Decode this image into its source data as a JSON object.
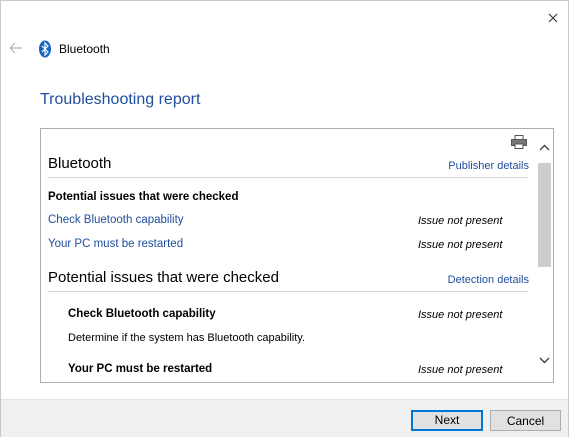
{
  "window": {
    "app_title": "Bluetooth",
    "page_title": "Troubleshooting report"
  },
  "report": {
    "section1_title": "Bluetooth",
    "publisher_link": "Publisher details",
    "checked_heading": "Potential issues that were checked",
    "items": [
      {
        "label": "Check Bluetooth capability",
        "status": "Issue not present"
      },
      {
        "label": "Your PC must be restarted",
        "status": "Issue not present"
      }
    ],
    "section2_title": "Potential issues that were checked",
    "detection_link": "Detection details",
    "details": [
      {
        "title": "Check Bluetooth capability",
        "status": "Issue not present",
        "description": "Determine if the system has Bluetooth capability."
      },
      {
        "title": "Your PC must be restarted",
        "status": "Issue not present"
      }
    ]
  },
  "footer": {
    "next_label": "Next",
    "cancel_label": "Cancel"
  },
  "colors": {
    "accent": "#0078d7",
    "link": "#1f4e9c"
  }
}
